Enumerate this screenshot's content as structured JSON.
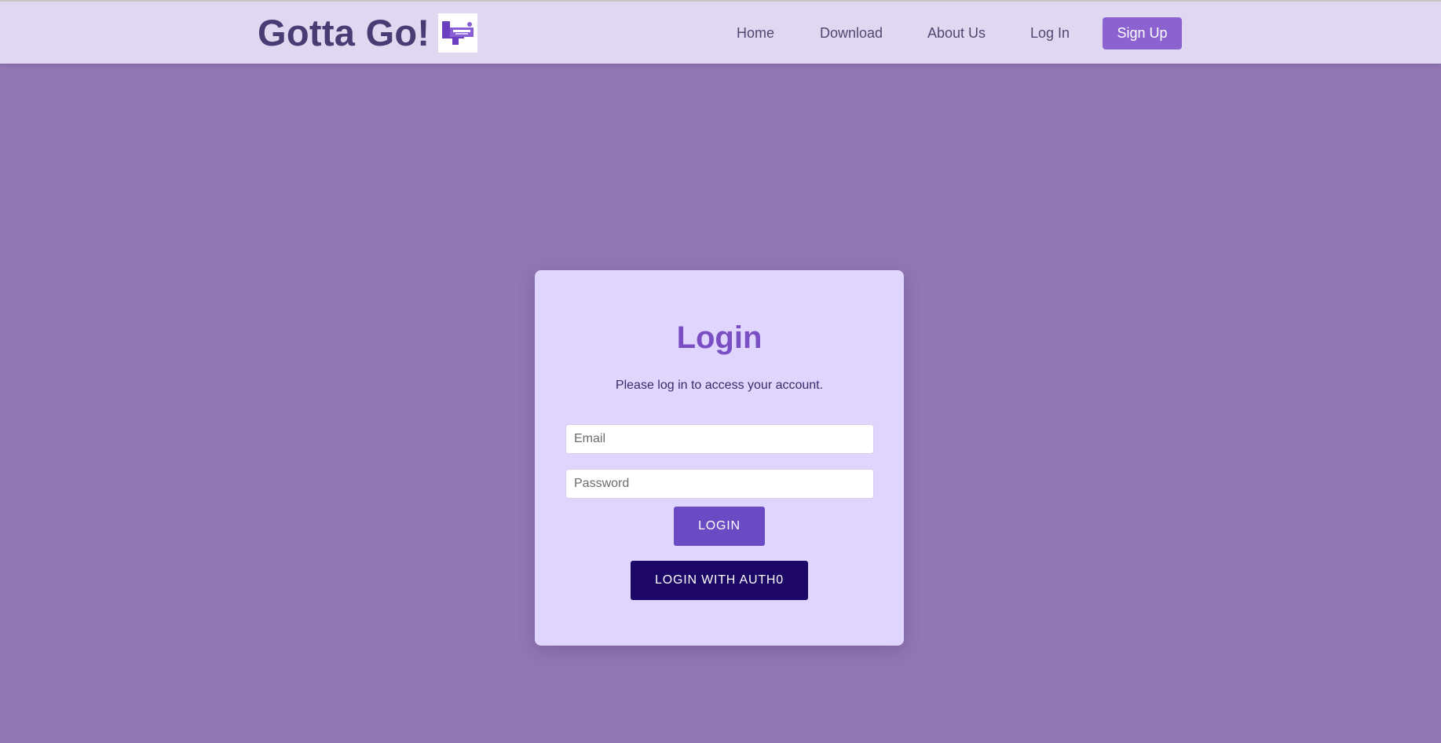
{
  "header": {
    "brand_title": "Gotta Go!",
    "logo_icon": "gotta-go-logo",
    "nav": [
      {
        "label": "Home"
      },
      {
        "label": "Download"
      },
      {
        "label": "About Us"
      },
      {
        "label": "Log In"
      }
    ],
    "signup_label": "Sign Up"
  },
  "login": {
    "title": "Login",
    "subtitle": "Please log in to access your account.",
    "email_placeholder": "Email",
    "email_value": "",
    "password_placeholder": "Password",
    "password_value": "",
    "login_button": "LOGIN",
    "auth0_button": "LOGIN WITH AUTH0"
  },
  "colors": {
    "page_background": "#9177b3",
    "navbar_background": "#e0d8f0",
    "brand": "#493c74",
    "accent": "#8c62d1",
    "card_background": "#e0d6fd",
    "title": "#7b4fc4",
    "login_button": "#6a4bc4",
    "auth0_button": "#1c0766"
  }
}
